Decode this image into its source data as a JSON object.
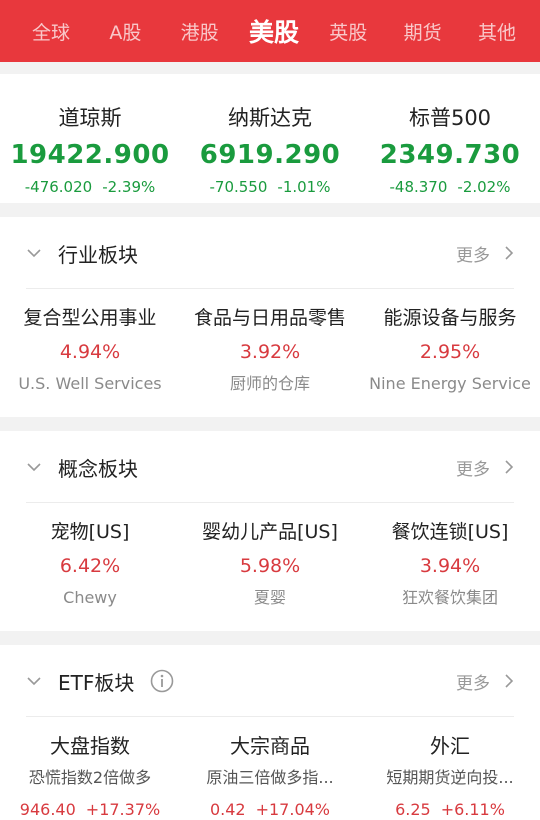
{
  "tabs": [
    "全球",
    "A股",
    "港股",
    "美股",
    "英股",
    "期货",
    "其他"
  ],
  "active_tab": "美股",
  "indices": [
    {
      "name": "道琼斯",
      "price": "19422.900",
      "change": "-476.020",
      "pct": "-2.39%"
    },
    {
      "name": "纳斯达克",
      "price": "6919.290",
      "change": "-70.550",
      "pct": "-1.01%"
    },
    {
      "name": "标普500",
      "price": "2349.730",
      "change": "-48.370",
      "pct": "-2.02%"
    }
  ],
  "industry": {
    "title": "行业板块",
    "more": "更多",
    "items": [
      {
        "name": "复合型公用事业",
        "pct": "4.94%",
        "sub": "U.S. Well Services"
      },
      {
        "name": "食品与日用品零售",
        "pct": "3.92%",
        "sub": "厨师的仓库"
      },
      {
        "name": "能源设备与服务",
        "pct": "2.95%",
        "sub": "Nine Energy Service"
      }
    ]
  },
  "concept": {
    "title": "概念板块",
    "more": "更多",
    "items": [
      {
        "name": "宠物[US]",
        "pct": "6.42%",
        "sub": "Chewy"
      },
      {
        "name": "婴幼儿产品[US]",
        "pct": "5.98%",
        "sub": "夏婴"
      },
      {
        "name": "餐饮连锁[US]",
        "pct": "3.94%",
        "sub": "狂欢餐饮集团"
      }
    ]
  },
  "etf": {
    "title": "ETF板块",
    "more": "更多",
    "items": [
      {
        "name": "大盘指数",
        "sub": "恐慌指数2倍做多",
        "price": "946.40",
        "pct": "+17.37%"
      },
      {
        "name": "大宗商品",
        "sub": "原油三倍做多指...",
        "price": "0.42",
        "pct": "+17.04%"
      },
      {
        "name": "外汇",
        "sub": "短期期货逆向投...",
        "price": "6.25",
        "pct": "+6.11%"
      }
    ]
  },
  "colors": {
    "brand_red": "#e8383d",
    "up_red": "#d83a3f",
    "down_green": "#1a9b3e"
  },
  "icons": [
    "chevron-down-icon",
    "chevron-right-icon",
    "info-icon"
  ]
}
